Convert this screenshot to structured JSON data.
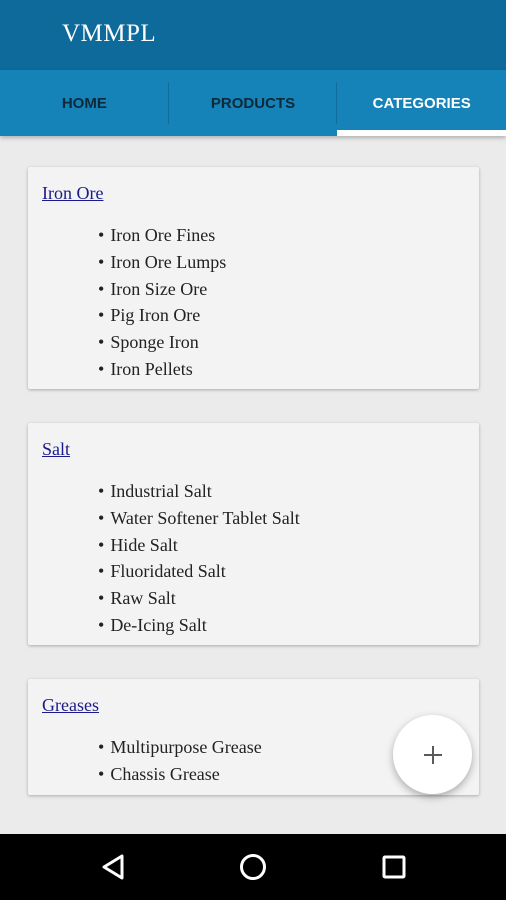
{
  "app": {
    "title": "VMMPL"
  },
  "tabs": [
    {
      "label": "HOME",
      "active": false
    },
    {
      "label": "PRODUCTS",
      "active": false
    },
    {
      "label": "CATEGORIES",
      "active": true
    }
  ],
  "categories": [
    {
      "title": "Iron Ore",
      "items": [
        "Iron Ore Fines",
        "Iron Ore Lumps",
        "Iron Size Ore",
        "Pig Iron Ore",
        "Sponge Iron",
        "Iron Pellets"
      ]
    },
    {
      "title": "Salt",
      "items": [
        "Industrial Salt",
        "Water Softener Tablet Salt",
        "Hide Salt",
        "Fluoridated Salt",
        "Raw Salt",
        "De-Icing Salt"
      ]
    },
    {
      "title": "Greases",
      "items": [
        "Multipurpose Grease",
        "Chassis Grease"
      ]
    }
  ],
  "fab": {
    "icon": "plus-icon"
  },
  "navigation": {
    "icons": [
      "back-icon",
      "home-icon",
      "recents-icon"
    ]
  },
  "colors": {
    "appbar": "#0d6a9a",
    "tabbar": "#1582b8",
    "link": "#1a1a8c",
    "card": "#f3f3f3",
    "background": "#ebebeb"
  }
}
